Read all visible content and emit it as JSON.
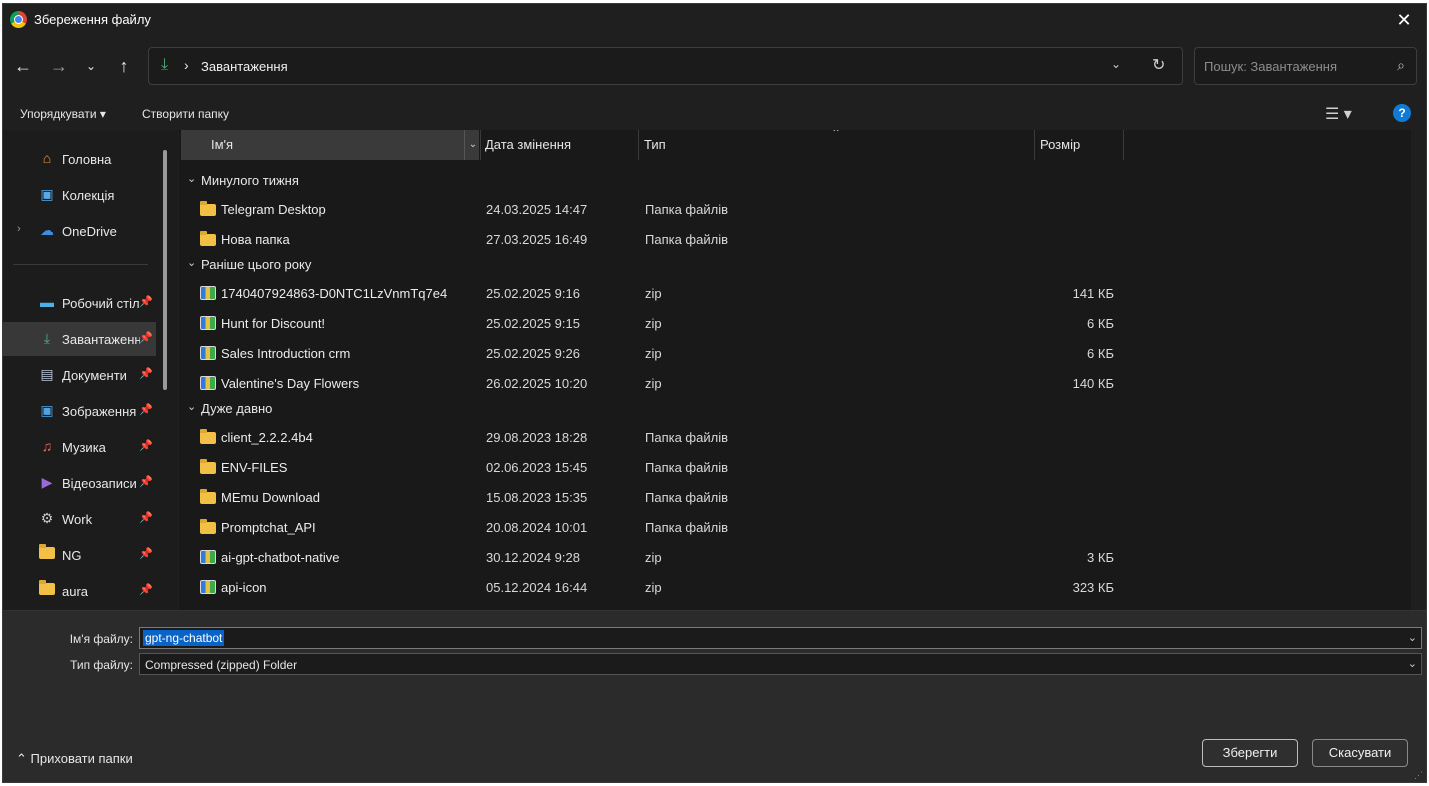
{
  "window": {
    "title": "Збереження файлу"
  },
  "nav": {
    "address_segment": "Завантаження",
    "search_placeholder": "Пошук: Завантаження"
  },
  "toolbar": {
    "organize_label": "Упорядкувати ▾",
    "new_folder_label": "Створити папку"
  },
  "sidebar": {
    "items": [
      {
        "label": "Головна",
        "icon": "home-icon",
        "pinned": false
      },
      {
        "label": "Колекція",
        "icon": "gallery-icon",
        "pinned": false
      },
      {
        "label": "OneDrive",
        "icon": "onedrive-icon",
        "pinned": false
      },
      {
        "label": "Робочий стіл",
        "icon": "desktop-icon",
        "pinned": true
      },
      {
        "label": "Завантаження",
        "icon": "download-icon",
        "pinned": true,
        "selected": true
      },
      {
        "label": "Документи",
        "icon": "documents-icon",
        "pinned": true
      },
      {
        "label": "Зображення",
        "icon": "pictures-icon",
        "pinned": true
      },
      {
        "label": "Музика",
        "icon": "music-icon",
        "pinned": true
      },
      {
        "label": "Відеозаписи",
        "icon": "videos-icon",
        "pinned": true
      },
      {
        "label": "Work",
        "icon": "work-folder-icon",
        "pinned": true
      },
      {
        "label": "NG",
        "icon": "folder-icon",
        "pinned": true
      },
      {
        "label": "aura",
        "icon": "folder-icon",
        "pinned": true
      }
    ]
  },
  "columns": {
    "name": "Ім'я",
    "date": "Дата змінення",
    "type": "Тип",
    "size": "Розмір"
  },
  "groups": [
    {
      "label": "Минулого тижня",
      "rows": [
        {
          "name": "Telegram Desktop",
          "date": "24.03.2025 14:47",
          "type": "Папка файлів",
          "size": "",
          "icon": "folder-icon"
        },
        {
          "name": "Нова папка",
          "date": "27.03.2025 16:49",
          "type": "Папка файлів",
          "size": "",
          "icon": "folder-icon"
        }
      ]
    },
    {
      "label": "Раніше цього року",
      "rows": [
        {
          "name": "1740407924863-D0NTC1LzVnmTq7e4",
          "date": "25.02.2025 9:16",
          "type": "zip",
          "size": "141 КБ",
          "icon": "zip-icon"
        },
        {
          "name": "Hunt for Discount!",
          "date": "25.02.2025 9:15",
          "type": "zip",
          "size": "6 КБ",
          "icon": "zip-icon"
        },
        {
          "name": "Sales Introduction crm",
          "date": "25.02.2025 9:26",
          "type": "zip",
          "size": "6 КБ",
          "icon": "zip-icon"
        },
        {
          "name": "Valentine's Day Flowers",
          "date": "26.02.2025 10:20",
          "type": "zip",
          "size": "140 КБ",
          "icon": "zip-icon"
        }
      ]
    },
    {
      "label": "Дуже давно",
      "rows": [
        {
          "name": "client_2.2.2.4b4",
          "date": "29.08.2023 18:28",
          "type": "Папка файлів",
          "size": "",
          "icon": "folder-icon"
        },
        {
          "name": "ENV-FILES",
          "date": "02.06.2023 15:45",
          "type": "Папка файлів",
          "size": "",
          "icon": "folder-icon"
        },
        {
          "name": "MEmu Download",
          "date": "15.08.2023 15:35",
          "type": "Папка файлів",
          "size": "",
          "icon": "folder-icon"
        },
        {
          "name": "Promptchat_API",
          "date": "20.08.2024 10:01",
          "type": "Папка файлів",
          "size": "",
          "icon": "folder-icon"
        },
        {
          "name": "ai-gpt-chatbot-native",
          "date": "30.12.2024 9:28",
          "type": "zip",
          "size": "3 КБ",
          "icon": "zip-icon"
        },
        {
          "name": "api-icon",
          "date": "05.12.2024 16:44",
          "type": "zip",
          "size": "323 КБ",
          "icon": "zip-icon"
        }
      ]
    }
  ],
  "form": {
    "filename_label": "Ім'я файлу:",
    "filename_value": "gpt-ng-chatbot",
    "filetype_label": "Тип файлу:",
    "filetype_value": "Compressed (zipped) Folder"
  },
  "footer": {
    "hide_folders_label": "Приховати папки",
    "save_label": "Зберегти",
    "cancel_label": "Скасувати"
  },
  "colors": {
    "accent": "#0a64c8",
    "background": "#1f1f1f"
  }
}
